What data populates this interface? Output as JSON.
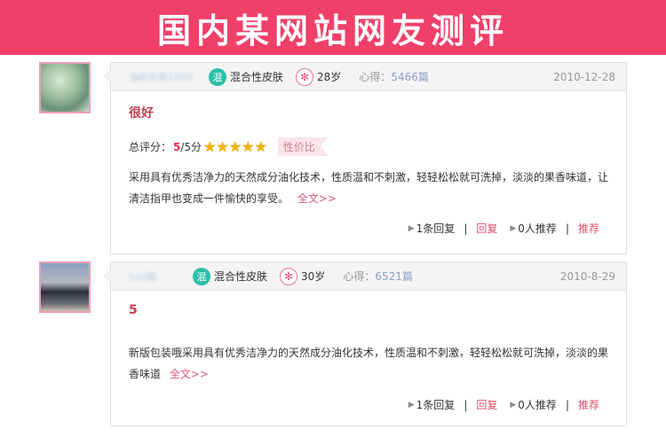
{
  "banner": {
    "title": "国内某网站网友测评"
  },
  "reviews": [
    {
      "username": "海鸥的鱼1009",
      "skin_icon": "混",
      "skin_type": "混合性皮肤",
      "age_icon": "✻",
      "age": "28岁",
      "exp_label": "心得：",
      "exp_count": "5466篇",
      "date": "2010-12-28",
      "title": "很好",
      "score_label": "总评分：",
      "score_value": "5",
      "score_max": "/5分",
      "stars": 5,
      "tag": "性价比",
      "body": "采用具有优秀洁净力的天然成分油化技术，性质温和不刺激，轻轻松松就可洗掉，淡淡的果香味道，让清洁指甲也变成一件愉快的享受。",
      "more": "全文>>",
      "reply_count": "1条回复",
      "reply_btn": "回复",
      "recommend_count": "0人推荐",
      "recommend_btn": "推荐"
    },
    {
      "username": "lulu猫",
      "skin_icon": "混",
      "skin_type": "混合性皮肤",
      "age_icon": "✻",
      "age": "30岁",
      "exp_label": "心得：",
      "exp_count": "6521篇",
      "date": "2010-8-29",
      "title": "5",
      "body": "新版包装哦采用具有优秀洁净力的天然成分油化技术，性质温和不刺激，轻轻松松就可洗掉，淡淡的果香味道",
      "more": "全文>>",
      "reply_count": "1条回复",
      "reply_btn": "回复",
      "recommend_count": "0人推荐",
      "recommend_btn": "推荐"
    }
  ]
}
